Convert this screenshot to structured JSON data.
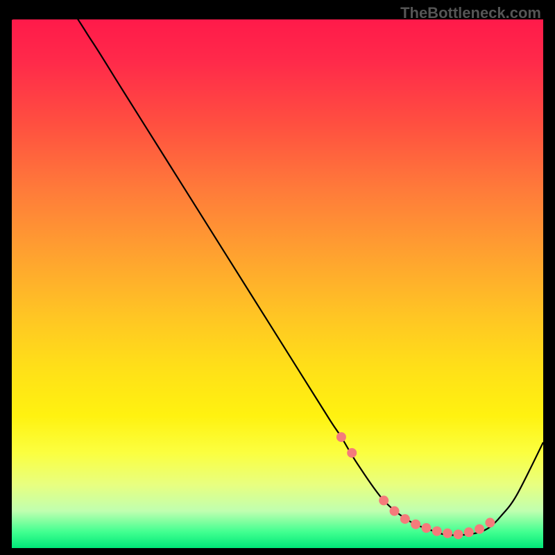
{
  "watermark": "TheBottleneck.com",
  "chart_data": {
    "type": "line",
    "title": "",
    "xlabel": "",
    "ylabel": "",
    "xlim": [
      0,
      100
    ],
    "ylim": [
      0,
      100
    ],
    "x": [
      0,
      5,
      10,
      15,
      20,
      25,
      30,
      35,
      40,
      45,
      50,
      55,
      60,
      62,
      65,
      70,
      75,
      80,
      82,
      85,
      88,
      90,
      92,
      95,
      100
    ],
    "values": [
      100,
      104,
      103,
      96,
      88,
      80,
      72,
      64,
      56,
      48,
      40,
      32,
      24,
      21,
      16,
      9,
      5,
      3,
      2.5,
      2.5,
      3,
      4,
      6,
      10,
      20
    ],
    "accent_points_x": [
      62,
      64,
      70,
      72,
      74,
      76,
      78,
      80,
      82,
      84,
      86,
      88,
      90
    ],
    "accent_points_y": [
      21,
      18,
      9,
      7,
      5.5,
      4.5,
      3.8,
      3.2,
      2.8,
      2.6,
      3,
      3.6,
      4.8
    ],
    "colors": {
      "line": "#000000",
      "accent": "#f47b7b",
      "gradient_top": "#ff1a4a",
      "gradient_mid": "#ffe018",
      "gradient_bottom": "#00e878"
    }
  }
}
